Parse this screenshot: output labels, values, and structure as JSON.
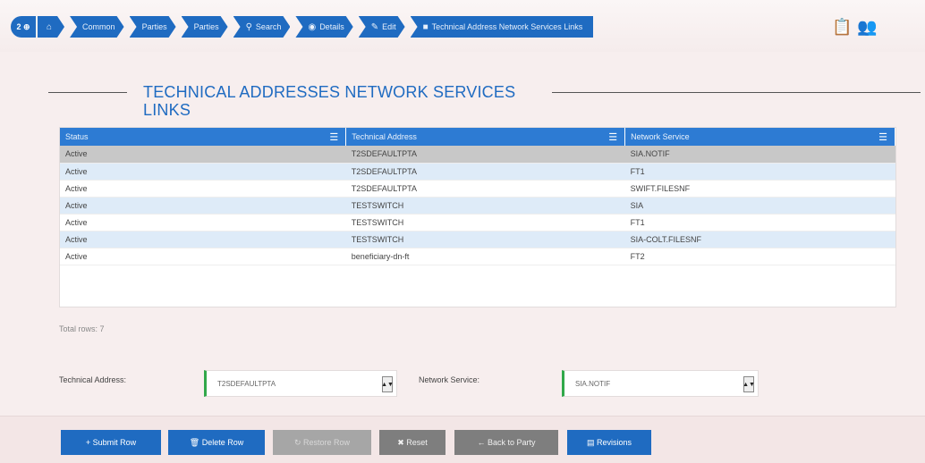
{
  "breadcrumb": {
    "badge": "2 ⊕",
    "items": [
      {
        "icon": "home-icon",
        "glyph": "⌂",
        "label": ""
      },
      {
        "icon": "",
        "glyph": "",
        "label": "Common"
      },
      {
        "icon": "",
        "glyph": "",
        "label": "Parties"
      },
      {
        "icon": "",
        "glyph": "",
        "label": "Parties"
      },
      {
        "icon": "search-icon",
        "glyph": "⚲",
        "label": "Search"
      },
      {
        "icon": "eye-icon",
        "glyph": "◉",
        "label": "Details"
      },
      {
        "icon": "edit-icon",
        "glyph": "✎",
        "label": "Edit"
      },
      {
        "icon": "bookmark-icon",
        "glyph": "■",
        "label": "Technical Address Network Services Links"
      }
    ]
  },
  "section": {
    "title_line1": "TECHNICAL ADDRESSES NETWORK SERVICES",
    "title_line2": "LINKS"
  },
  "table": {
    "columns": [
      "Status",
      "Technical Address",
      "Network Service"
    ],
    "rows": [
      [
        "Active",
        "T2SDEFAULTPTA",
        "SIA.NOTIF"
      ],
      [
        "Active",
        "T2SDEFAULTPTA",
        "FT1"
      ],
      [
        "Active",
        "T2SDEFAULTPTA",
        "SWIFT.FILESNF"
      ],
      [
        "Active",
        "TESTSWITCH",
        "SIA"
      ],
      [
        "Active",
        "TESTSWITCH",
        "FT1"
      ],
      [
        "Active",
        "TESTSWITCH",
        "SIA-COLT.FILESNF"
      ],
      [
        "Active",
        "beneficiary-dn-ft",
        "FT2"
      ]
    ],
    "total_rows": "Total rows: 7"
  },
  "form": {
    "technical_address_label": "Technical Address:",
    "technical_address_value": "T2SDEFAULTPTA",
    "network_service_label": "Network Service:",
    "network_service_value": "SIA.NOTIF"
  },
  "buttons": {
    "submit_row": "+ Submit Row",
    "delete_row": "🗑 Delete Row",
    "restore_row": "↻ Restore Row",
    "reset": "✖ Reset",
    "back_to_party": "← Back to Party",
    "revisions": "▤ Revisions"
  },
  "colors": {
    "accent": "#1f6bc1",
    "header_blue": "#2d7bd3",
    "selected_row": "#c8c8c8",
    "alt_row": "#deebf8",
    "field_marker": "#31a84a"
  }
}
